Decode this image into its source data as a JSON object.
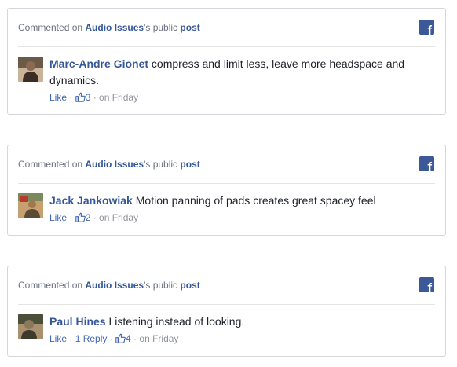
{
  "comments": [
    {
      "prefix": "Commented on",
      "page": "Audio Issues",
      "suffix": "'s public",
      "post_link": "post",
      "author": "Marc-Andre Gionet",
      "text": " compress and limit less, leave more headspace and dynamics.",
      "like_label": "Like",
      "like_count": "3",
      "time": "on Friday",
      "brand_icon": "facebook-logo",
      "avatar_colors": [
        "#3a2e26",
        "#6b5a48",
        "#c9b49a"
      ]
    },
    {
      "prefix": "Commented on",
      "page": "Audio Issues",
      "suffix": "'s public",
      "post_link": "post",
      "author": "Jack Jankowiak",
      "text": " Motion panning of pads creates great spacey feel",
      "like_label": "Like",
      "like_count": "2",
      "time": "on Friday",
      "brand_icon": "facebook-logo",
      "avatar_colors": [
        "#7a8a5c",
        "#c8a070",
        "#b83a2e"
      ]
    },
    {
      "prefix": "Commented on",
      "page": "Audio Issues",
      "suffix": "'s public",
      "post_link": "post",
      "author": "Paul Hines",
      "text": " Listening instead of looking.",
      "like_label": "Like",
      "reply_label": "1 Reply",
      "like_count": "4",
      "time": "on Friday",
      "brand_icon": "facebook-logo",
      "avatar_colors": [
        "#4a4f3a",
        "#8a7a5a",
        "#a89070"
      ]
    }
  ],
  "colors": {
    "link": "#365899",
    "fb_blue": "#3b5998",
    "meta": "#90949c"
  }
}
